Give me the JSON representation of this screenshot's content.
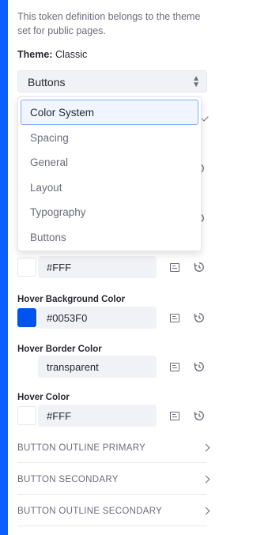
{
  "description": "This token definition belongs to the theme set for public pages.",
  "theme": {
    "label": "Theme:",
    "value": "Classic"
  },
  "category_select": {
    "value": "Buttons"
  },
  "dropdown": {
    "items": [
      {
        "label": "Color System",
        "active": true
      },
      {
        "label": "Spacing",
        "active": false
      },
      {
        "label": "General",
        "active": false
      },
      {
        "label": "Layout",
        "active": false
      },
      {
        "label": "Typography",
        "active": false
      },
      {
        "label": "Buttons",
        "active": false
      }
    ]
  },
  "fields": [
    {
      "label": "",
      "value": "#FFF",
      "swatch_color": "#ffffff"
    },
    {
      "label": "Hover Background Color",
      "value": "#0053F0",
      "swatch_color": "#0053f0"
    },
    {
      "label": "Hover Border Color",
      "value": "transparent",
      "swatch_color": "transparent"
    },
    {
      "label": "Hover Color",
      "value": "#FFF",
      "swatch_color": "#ffffff"
    }
  ],
  "sections": [
    {
      "label": "BUTTON OUTLINE PRIMARY"
    },
    {
      "label": "BUTTON SECONDARY"
    },
    {
      "label": "BUTTON OUTLINE SECONDARY"
    }
  ],
  "colors": {
    "accent": "#0b5fff",
    "muted_text": "#6b6c7e",
    "field_bg": "#f1f2f5"
  }
}
